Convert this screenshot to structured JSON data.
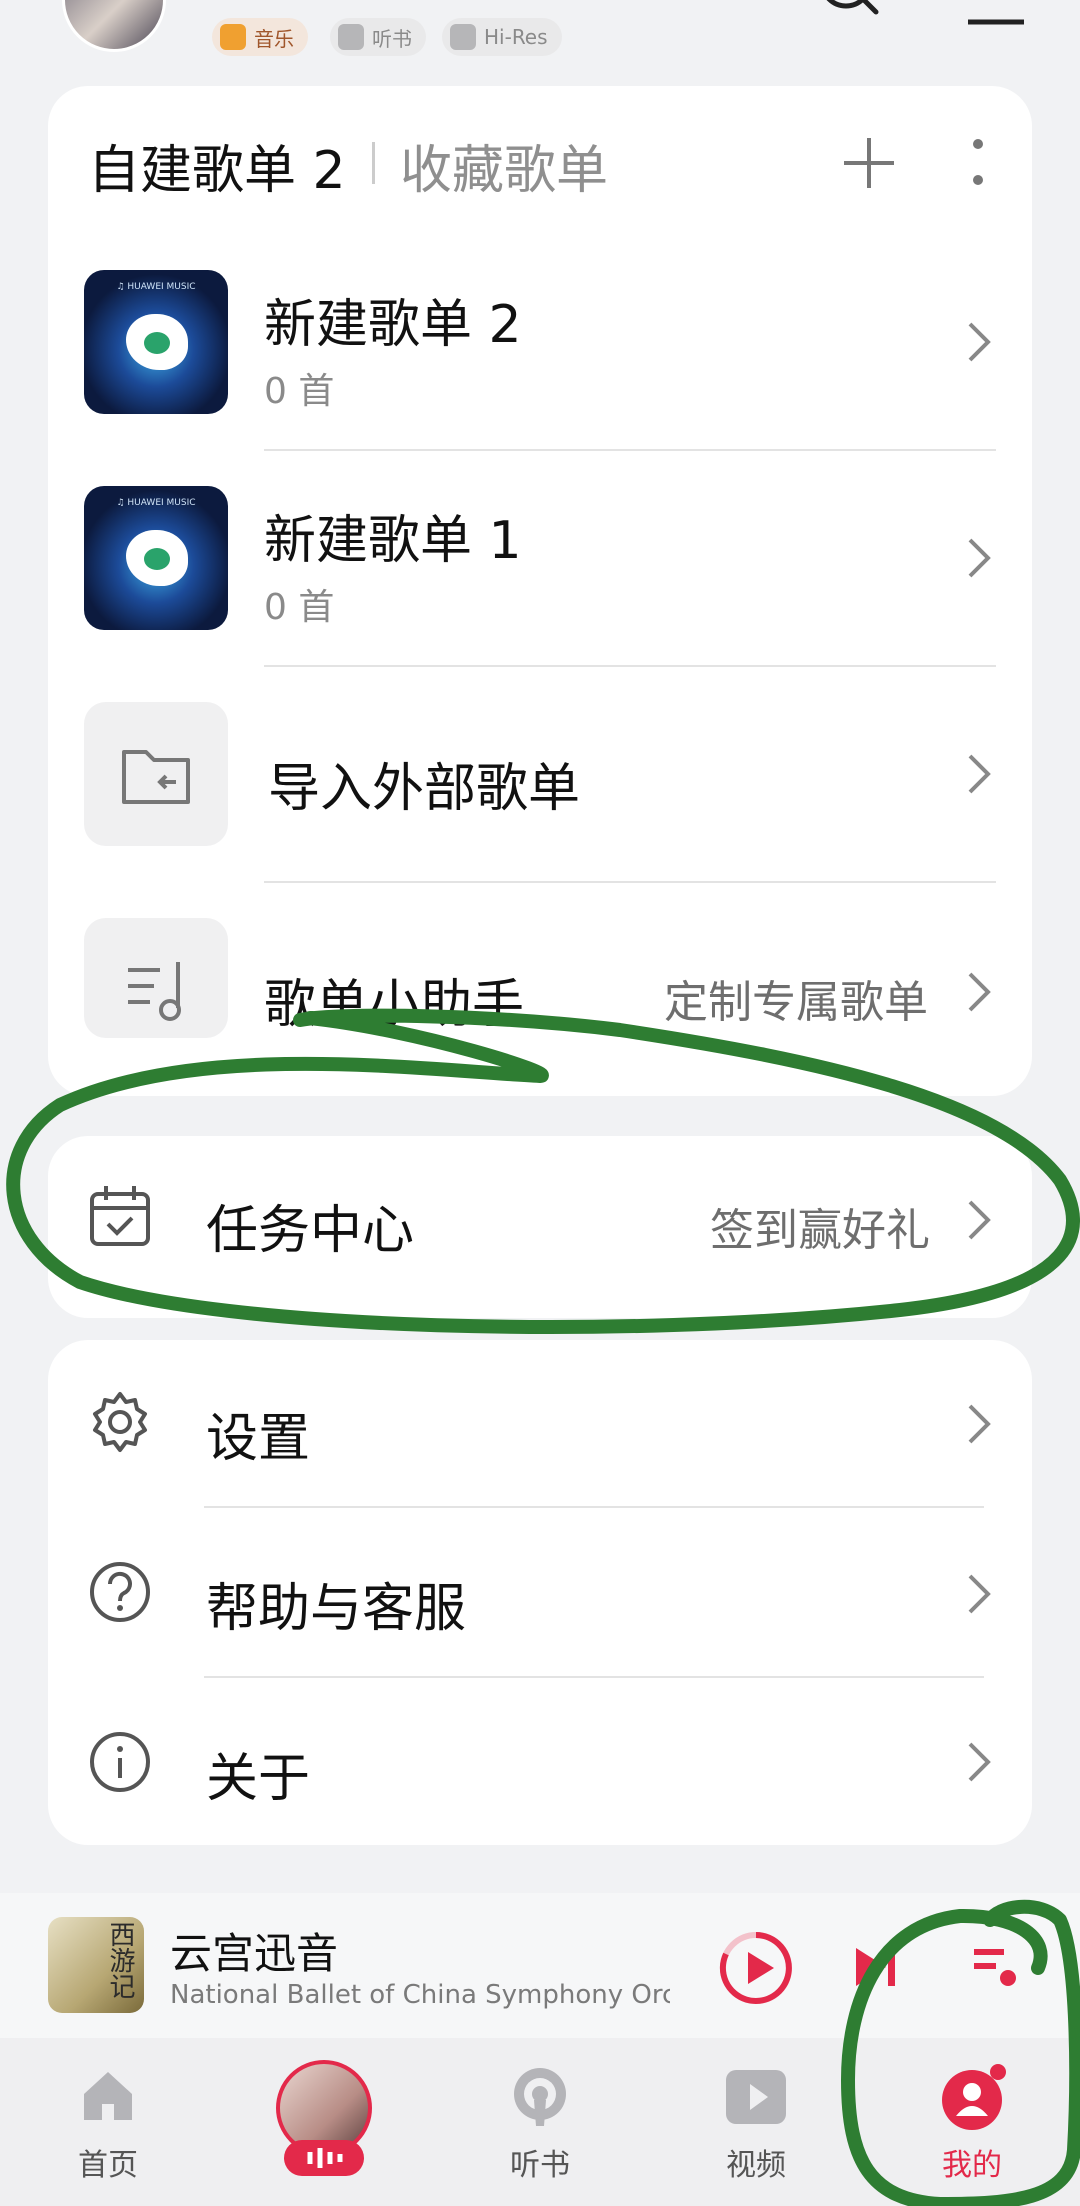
{
  "header": {
    "badges": [
      {
        "label": "音乐"
      },
      {
        "label": "听书"
      },
      {
        "label": "Hi-Res"
      }
    ]
  },
  "playlists": {
    "tab_created": "自建歌单 2",
    "tab_favorites": "收藏歌单",
    "items": [
      {
        "title": "新建歌单 2",
        "count": "0 首",
        "cover_label": "♫ HUAWEI MUSIC"
      },
      {
        "title": "新建歌单 1",
        "count": "0 首",
        "cover_label": "♫ HUAWEI MUSIC"
      }
    ],
    "import_label": "导入外部歌单",
    "assistant_label": "歌单小助手",
    "assistant_hint": "定制专属歌单"
  },
  "tasks": {
    "label": "任务中心",
    "hint": "签到赢好礼"
  },
  "settings": {
    "items": [
      {
        "label": "设置",
        "icon": "gear-icon"
      },
      {
        "label": "帮助与客服",
        "icon": "help-icon"
      },
      {
        "label": "关于",
        "icon": "info-icon"
      }
    ]
  },
  "player": {
    "album_text": "西游记",
    "song": "云宫迅音",
    "artist": "National Ballet of China Symphony Orc ···"
  },
  "nav": {
    "items": [
      {
        "label": "首页"
      },
      {
        "label": ""
      },
      {
        "label": "听书"
      },
      {
        "label": "视频"
      },
      {
        "label": "我的"
      }
    ],
    "active_color": "#e3294a"
  },
  "colors": {
    "accent": "#e3294a",
    "annotation_green": "#2e7d32"
  }
}
